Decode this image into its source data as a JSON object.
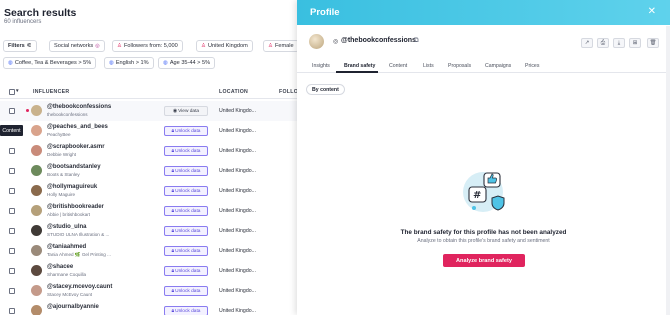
{
  "search": {
    "title": "Search results",
    "count": "60 influencers",
    "filters_label": "Filters",
    "chips_row1": [
      "Social networks",
      "Followers from: 5,000",
      "United Kingdom",
      "Female"
    ],
    "chips_row2": [
      "Coffee, Tea & Beverages > 5%",
      "English > 1%",
      "Age 35-44 > 5%"
    ]
  },
  "table": {
    "headers": {
      "influencer": "INFLUENCER",
      "location": "LOCATION",
      "followers": "FOLLO"
    },
    "view_label": "View data",
    "unlock_label": "Unlock data",
    "rows": [
      {
        "name": "@thebookconfessions",
        "sub": "thebookconfessions",
        "location": "United Kingdo...",
        "action": "view",
        "avatar_color": "#c9b28c"
      },
      {
        "name": "@peaches_and_bees",
        "sub": "PeachyBee",
        "location": "United Kingdo...",
        "action": "unlock",
        "avatar_color": "#d9a38c"
      },
      {
        "name": "@scrapbooker.asmr",
        "sub": "Debbie Wright",
        "location": "United Kingdo...",
        "action": "unlock",
        "avatar_color": "#c98b7a"
      },
      {
        "name": "@bootsandstanley",
        "sub": "Boots & Stanley",
        "location": "United Kingdo...",
        "action": "unlock",
        "avatar_color": "#6d8a5c"
      },
      {
        "name": "@hollymaguireuk",
        "sub": "Holly Maguire",
        "location": "United Kingdo...",
        "action": "unlock",
        "avatar_color": "#8a6a4c"
      },
      {
        "name": "@britishbookreader",
        "sub": "Abbie | britishbookart",
        "location": "United Kingdo...",
        "action": "unlock",
        "avatar_color": "#b5a07a"
      },
      {
        "name": "@studio_ulna",
        "sub": "STUDIO ULNA Illustration & ...",
        "location": "United Kingdo...",
        "action": "unlock",
        "avatar_color": "#3f3a36"
      },
      {
        "name": "@taniaahmed",
        "sub": "Tania Ahmed 🌿 Gel Printing ...",
        "location": "United Kingdo...",
        "action": "unlock",
        "avatar_color": "#9a8a7a"
      },
      {
        "name": "@shacee",
        "sub": "Sharmane Coquilla",
        "location": "United Kingdo...",
        "action": "unlock",
        "avatar_color": "#5c4a3f"
      },
      {
        "name": "@stacey.mcevoy.caunt",
        "sub": "Stacey McEvoy Caunt",
        "location": "United Kingdo...",
        "action": "unlock",
        "avatar_color": "#c49a8a"
      },
      {
        "name": "@ajournalbyannie",
        "sub": "",
        "location": "United Kingdo...",
        "action": "unlock",
        "avatar_color": "#b38c6a"
      }
    ]
  },
  "tooltip": "Content",
  "drawer": {
    "title": "Profile",
    "handle": "@thebookconfessions",
    "tabs": [
      "Insights",
      "Brand safety",
      "Content",
      "Lists",
      "Proposals",
      "Campaigns",
      "Prices"
    ],
    "active_tab": "Brand safety",
    "by_content": "By content",
    "empty_title": "The brand safety for this profile has not been analyzed",
    "empty_sub": "Analyze to obtain this profile's brand safety and sentiment",
    "analyze_button": "Analyze brand safety"
  },
  "icons": {
    "close": "close-icon",
    "instagram": "instagram-icon",
    "external": "external-link-icon"
  },
  "colors": {
    "header_gradient_start": "#39bfe0",
    "primary": "#e0245e",
    "unlock": "#5b4bdc"
  }
}
